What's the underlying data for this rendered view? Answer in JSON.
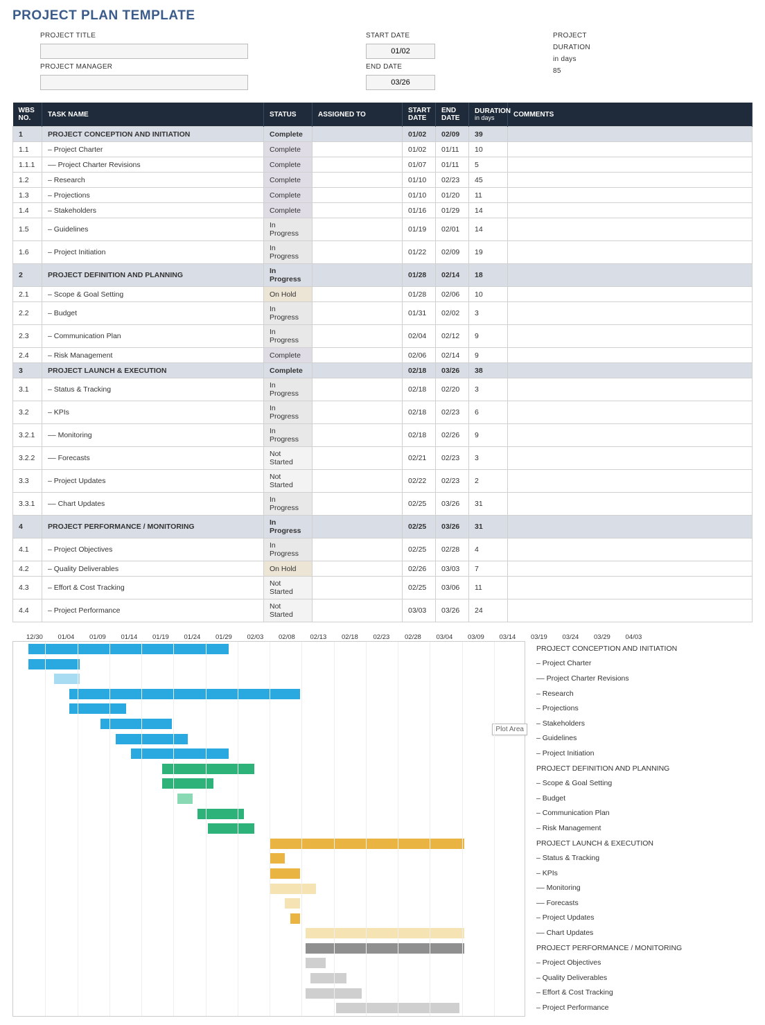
{
  "title": "PROJECT PLAN TEMPLATE",
  "meta": {
    "projectTitleLabel": "PROJECT TITLE",
    "projectTitle": "",
    "projectManagerLabel": "PROJECT MANAGER",
    "projectManager": "",
    "startDateLabel": "START DATE",
    "startDate": "01/02",
    "endDateLabel": "END DATE",
    "endDate": "03/26",
    "projDurLabel1": "PROJECT",
    "projDurLabel2": "DURATION",
    "projDurUnit": "in days",
    "projDur": "85"
  },
  "plotTag": "Plot Area",
  "columns": {
    "wbs": "WBS NO.",
    "task": "TASK NAME",
    "status": "STATUS",
    "assigned": "ASSIGNED TO",
    "start": "START DATE",
    "end": "END DATE",
    "dur": "DURATION",
    "durSub": "in days",
    "comments": "COMMENTS"
  },
  "rows": [
    {
      "wbs": "1",
      "task": "PROJECT CONCEPTION AND INITIATION",
      "status": "Complete",
      "assigned": "",
      "start": "01/02",
      "end": "02/09",
      "dur": "39",
      "phase": true,
      "indent": 0
    },
    {
      "wbs": "1.1",
      "task": "– Project Charter",
      "status": "Complete",
      "assigned": "",
      "start": "01/02",
      "end": "01/11",
      "dur": "10",
      "indent": 1
    },
    {
      "wbs": "1.1.1",
      "task": "–– Project Charter Revisions",
      "status": "Complete",
      "assigned": "",
      "start": "01/07",
      "end": "01/11",
      "dur": "5",
      "indent": 2
    },
    {
      "wbs": "1.2",
      "task": "– Research",
      "status": "Complete",
      "assigned": "",
      "start": "01/10",
      "end": "02/23",
      "dur": "45",
      "indent": 1
    },
    {
      "wbs": "1.3",
      "task": "– Projections",
      "status": "Complete",
      "assigned": "",
      "start": "01/10",
      "end": "01/20",
      "dur": "11",
      "indent": 1
    },
    {
      "wbs": "1.4",
      "task": "– Stakeholders",
      "status": "Complete",
      "assigned": "",
      "start": "01/16",
      "end": "01/29",
      "dur": "14",
      "indent": 1
    },
    {
      "wbs": "1.5",
      "task": "– Guidelines",
      "status": "In Progress",
      "assigned": "",
      "start": "01/19",
      "end": "02/01",
      "dur": "14",
      "indent": 1
    },
    {
      "wbs": "1.6",
      "task": "– Project Initiation",
      "status": "In Progress",
      "assigned": "",
      "start": "01/22",
      "end": "02/09",
      "dur": "19",
      "indent": 1
    },
    {
      "wbs": "2",
      "task": "PROJECT DEFINITION AND PLANNING",
      "status": "In Progress",
      "assigned": "",
      "start": "01/28",
      "end": "02/14",
      "dur": "18",
      "phase": true,
      "indent": 0
    },
    {
      "wbs": "2.1",
      "task": "– Scope & Goal Setting",
      "status": "On Hold",
      "assigned": "",
      "start": "01/28",
      "end": "02/06",
      "dur": "10",
      "indent": 1
    },
    {
      "wbs": "2.2",
      "task": "– Budget",
      "status": "In Progress",
      "assigned": "",
      "start": "01/31",
      "end": "02/02",
      "dur": "3",
      "indent": 1
    },
    {
      "wbs": "2.3",
      "task": "– Communication Plan",
      "status": "In Progress",
      "assigned": "",
      "start": "02/04",
      "end": "02/12",
      "dur": "9",
      "indent": 1
    },
    {
      "wbs": "2.4",
      "task": "– Risk Management",
      "status": "Complete",
      "assigned": "",
      "start": "02/06",
      "end": "02/14",
      "dur": "9",
      "indent": 1
    },
    {
      "wbs": "3",
      "task": "PROJECT LAUNCH & EXECUTION",
      "status": "Complete",
      "assigned": "",
      "start": "02/18",
      "end": "03/26",
      "dur": "38",
      "phase": true,
      "indent": 0
    },
    {
      "wbs": "3.1",
      "task": "– Status & Tracking",
      "status": "In Progress",
      "assigned": "",
      "start": "02/18",
      "end": "02/20",
      "dur": "3",
      "indent": 1
    },
    {
      "wbs": "3.2",
      "task": "– KPIs",
      "status": "In Progress",
      "assigned": "",
      "start": "02/18",
      "end": "02/23",
      "dur": "6",
      "indent": 1
    },
    {
      "wbs": "3.2.1",
      "task": "–– Monitoring",
      "status": "In Progress",
      "assigned": "",
      "start": "02/18",
      "end": "02/26",
      "dur": "9",
      "indent": 1
    },
    {
      "wbs": "3.2.2",
      "task": "–– Forecasts",
      "status": "Not Started",
      "assigned": "",
      "start": "02/21",
      "end": "02/23",
      "dur": "3",
      "indent": 1
    },
    {
      "wbs": "3.3",
      "task": "– Project Updates",
      "status": "Not Started",
      "assigned": "",
      "start": "02/22",
      "end": "02/23",
      "dur": "2",
      "indent": 1
    },
    {
      "wbs": "3.3.1",
      "task": "–– Chart Updates",
      "status": "In Progress",
      "assigned": "",
      "start": "02/25",
      "end": "03/26",
      "dur": "31",
      "indent": 1
    },
    {
      "wbs": "4",
      "task": "PROJECT PERFORMANCE / MONITORING",
      "status": "In Progress",
      "assigned": "",
      "start": "02/25",
      "end": "03/26",
      "dur": "31",
      "phase": true,
      "indent": 0
    },
    {
      "wbs": "4.1",
      "task": "– Project Objectives",
      "status": "In Progress",
      "assigned": "",
      "start": "02/25",
      "end": "02/28",
      "dur": "4",
      "indent": 1
    },
    {
      "wbs": "4.2",
      "task": "– Quality Deliverables",
      "status": "On Hold",
      "assigned": "",
      "start": "02/26",
      "end": "03/03",
      "dur": "7",
      "indent": 1
    },
    {
      "wbs": "4.3",
      "task": "– Effort & Cost Tracking",
      "status": "Not Started",
      "assigned": "",
      "start": "02/25",
      "end": "03/06",
      "dur": "11",
      "indent": 1
    },
    {
      "wbs": "4.4",
      "task": "– Project Performance",
      "status": "Not Started",
      "assigned": "",
      "start": "03/03",
      "end": "03/26",
      "dur": "24",
      "indent": 1
    }
  ],
  "chart_data": {
    "type": "bar",
    "orientation": "horizontal-gantt",
    "x_axis_ticks": [
      "12/30",
      "01/04",
      "01/09",
      "01/14",
      "01/19",
      "01/24",
      "01/29",
      "02/03",
      "02/08",
      "02/13",
      "02/18",
      "02/23",
      "02/28",
      "03/04",
      "03/09",
      "03/14",
      "03/19",
      "03/24",
      "03/29",
      "04/03"
    ],
    "x_origin_date": "12/30",
    "days_span": 100,
    "series": [
      {
        "name": "PROJECT CONCEPTION AND INITIATION",
        "offset_days": 3,
        "duration_days": 39,
        "color": "c1"
      },
      {
        "name": "– Project Charter",
        "offset_days": 3,
        "duration_days": 10,
        "color": "c1"
      },
      {
        "name": "–– Project Charter Revisions",
        "offset_days": 8,
        "duration_days": 5,
        "color": "c1b"
      },
      {
        "name": "– Research",
        "offset_days": 11,
        "duration_days": 45,
        "color": "c1"
      },
      {
        "name": "– Projections",
        "offset_days": 11,
        "duration_days": 11,
        "color": "c1"
      },
      {
        "name": "– Stakeholders",
        "offset_days": 17,
        "duration_days": 14,
        "color": "c1"
      },
      {
        "name": "– Guidelines",
        "offset_days": 20,
        "duration_days": 14,
        "color": "c1"
      },
      {
        "name": "– Project Initiation",
        "offset_days": 23,
        "duration_days": 19,
        "color": "c1"
      },
      {
        "name": "PROJECT DEFINITION AND PLANNING",
        "offset_days": 29,
        "duration_days": 18,
        "color": "c2"
      },
      {
        "name": "– Scope & Goal Setting",
        "offset_days": 29,
        "duration_days": 10,
        "color": "c2"
      },
      {
        "name": "– Budget",
        "offset_days": 32,
        "duration_days": 3,
        "color": "c2b"
      },
      {
        "name": "– Communication Plan",
        "offset_days": 36,
        "duration_days": 9,
        "color": "c2"
      },
      {
        "name": "– Risk Management",
        "offset_days": 38,
        "duration_days": 9,
        "color": "c2"
      },
      {
        "name": "PROJECT LAUNCH & EXECUTION",
        "offset_days": 50,
        "duration_days": 38,
        "color": "c3"
      },
      {
        "name": "– Status & Tracking",
        "offset_days": 50,
        "duration_days": 3,
        "color": "c3"
      },
      {
        "name": "– KPIs",
        "offset_days": 50,
        "duration_days": 6,
        "color": "c3"
      },
      {
        "name": "–– Monitoring",
        "offset_days": 50,
        "duration_days": 9,
        "color": "c3b"
      },
      {
        "name": "–– Forecasts",
        "offset_days": 53,
        "duration_days": 3,
        "color": "c3b"
      },
      {
        "name": "– Project Updates",
        "offset_days": 54,
        "duration_days": 2,
        "color": "c3"
      },
      {
        "name": "–– Chart Updates",
        "offset_days": 57,
        "duration_days": 31,
        "color": "c3b"
      },
      {
        "name": "PROJECT PERFORMANCE / MONITORING",
        "offset_days": 57,
        "duration_days": 31,
        "color": "c4"
      },
      {
        "name": "– Project Objectives",
        "offset_days": 57,
        "duration_days": 4,
        "color": "c4b"
      },
      {
        "name": "– Quality Deliverables",
        "offset_days": 58,
        "duration_days": 7,
        "color": "c4b"
      },
      {
        "name": "– Effort & Cost Tracking",
        "offset_days": 57,
        "duration_days": 11,
        "color": "c4b"
      },
      {
        "name": "– Project Performance",
        "offset_days": 63,
        "duration_days": 24,
        "color": "c4b"
      }
    ]
  }
}
